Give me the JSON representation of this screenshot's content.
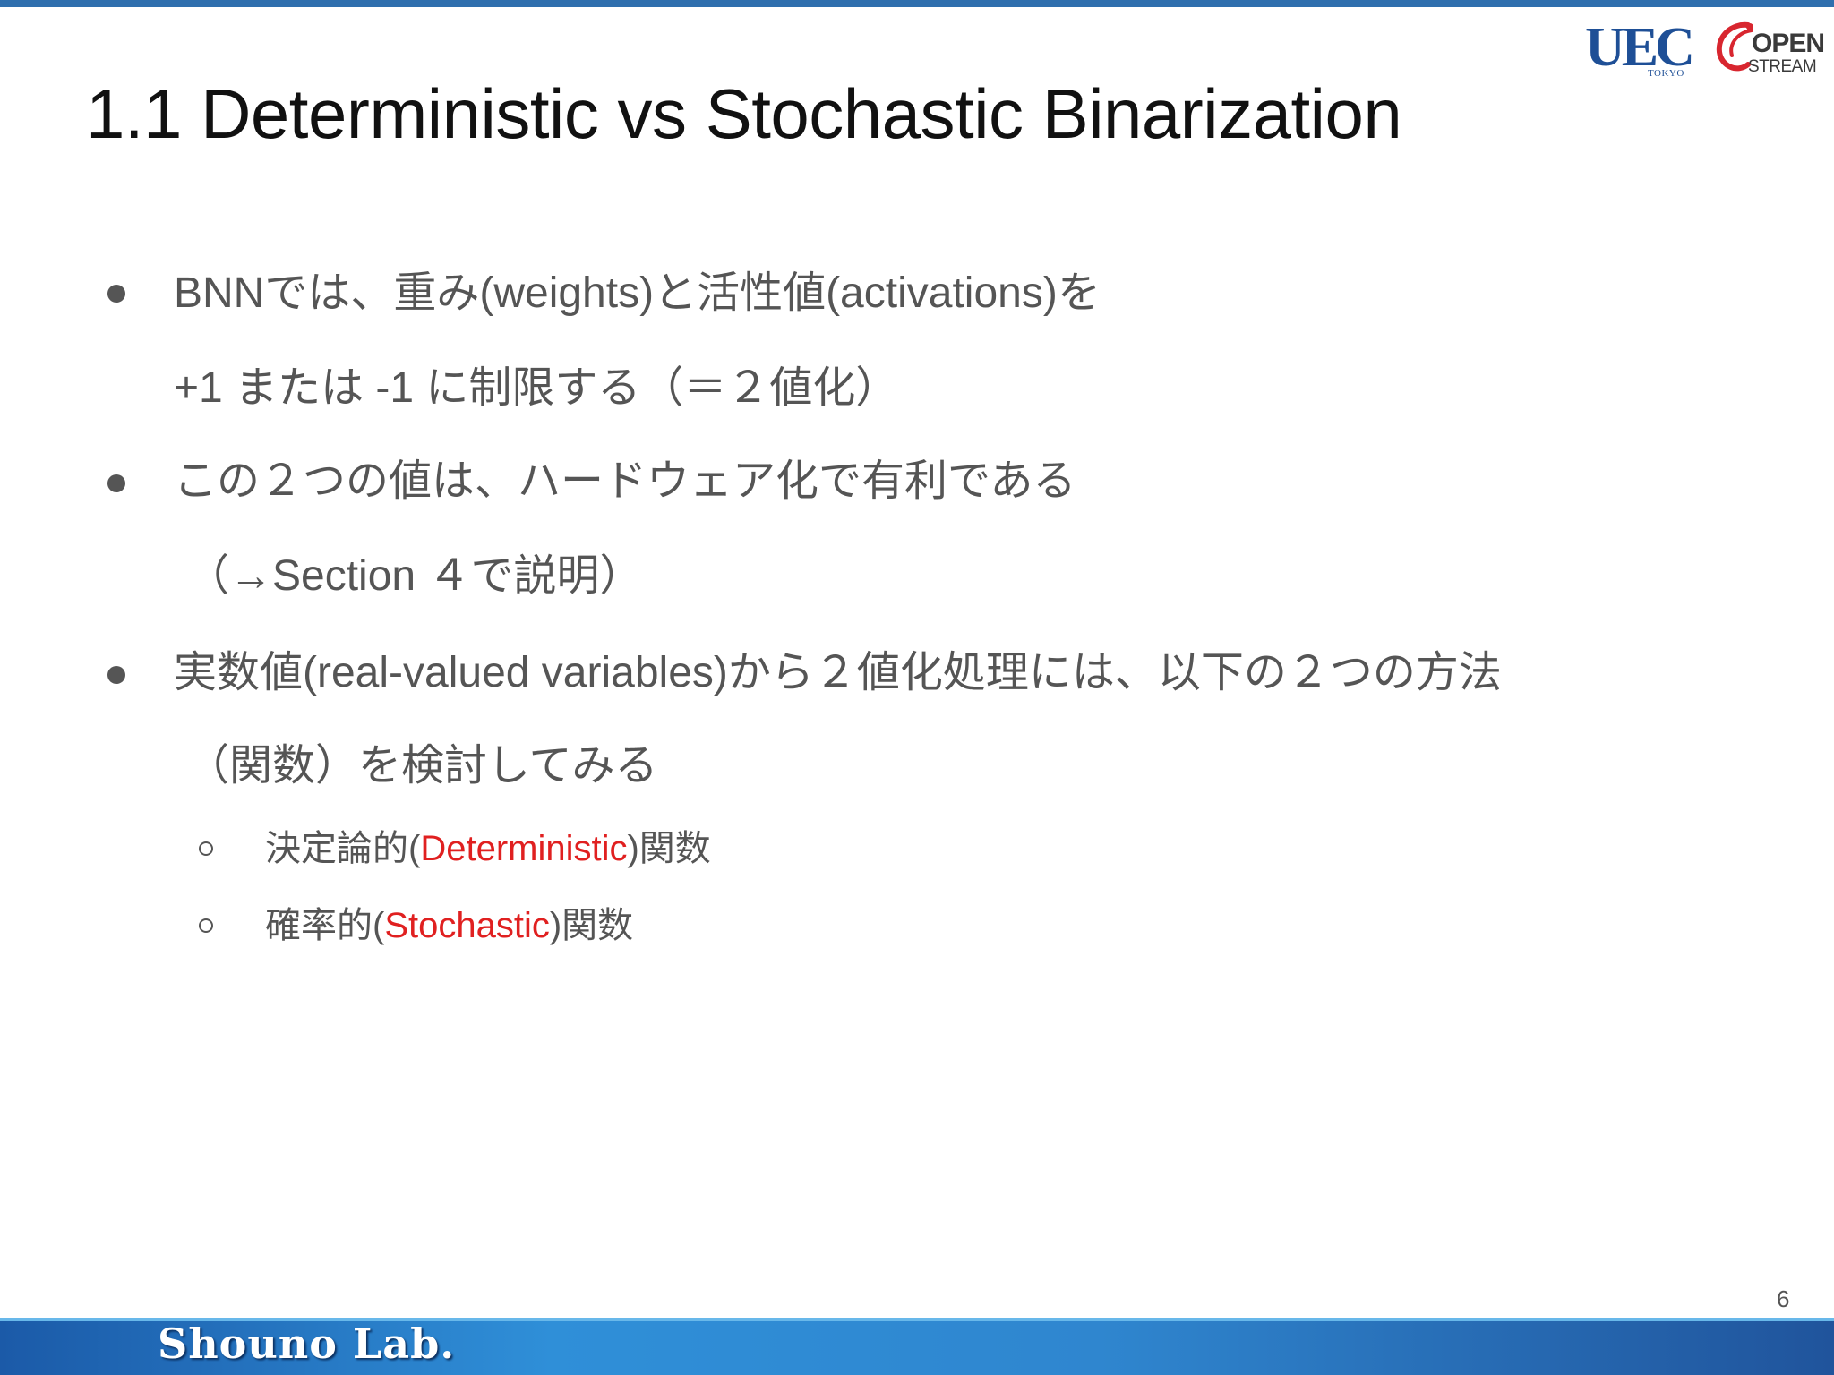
{
  "slide": {
    "title": "1.1 Deterministic vs Stochastic Binarization",
    "page_number": "6",
    "footer_label": "Shouno Lab."
  },
  "logos": {
    "uec": {
      "text": "UEC",
      "sub": "TOKYO",
      "color": "#1e4f96"
    },
    "openstream": {
      "line1": "OPEN",
      "line2": "STREAM",
      "mark_color": "#d8262f"
    }
  },
  "bullets": [
    {
      "lines": [
        "BNNでは、重み(weights)と活性値(activations)を",
        "+1 または -1 に制限する（＝２値化）"
      ]
    },
    {
      "lines": [
        "この２つの値は、ハードウェア化で有利である",
        "（→Section ４で説明）"
      ]
    },
    {
      "lines": [
        "実数値(real-valued variables)から２値化処理には、以下の２つの方法",
        "（関数）を検討してみる"
      ],
      "sub_items": [
        {
          "prefix": "決定論的(",
          "highlight": "Deterministic",
          "suffix": ")関数"
        },
        {
          "prefix": "確率的(",
          "highlight": "Stochastic",
          "suffix": ")関数"
        }
      ]
    }
  ],
  "colors": {
    "highlight": "#e02020",
    "body_text": "#555555",
    "title_text": "#111111",
    "footer": "#2f86cf"
  }
}
